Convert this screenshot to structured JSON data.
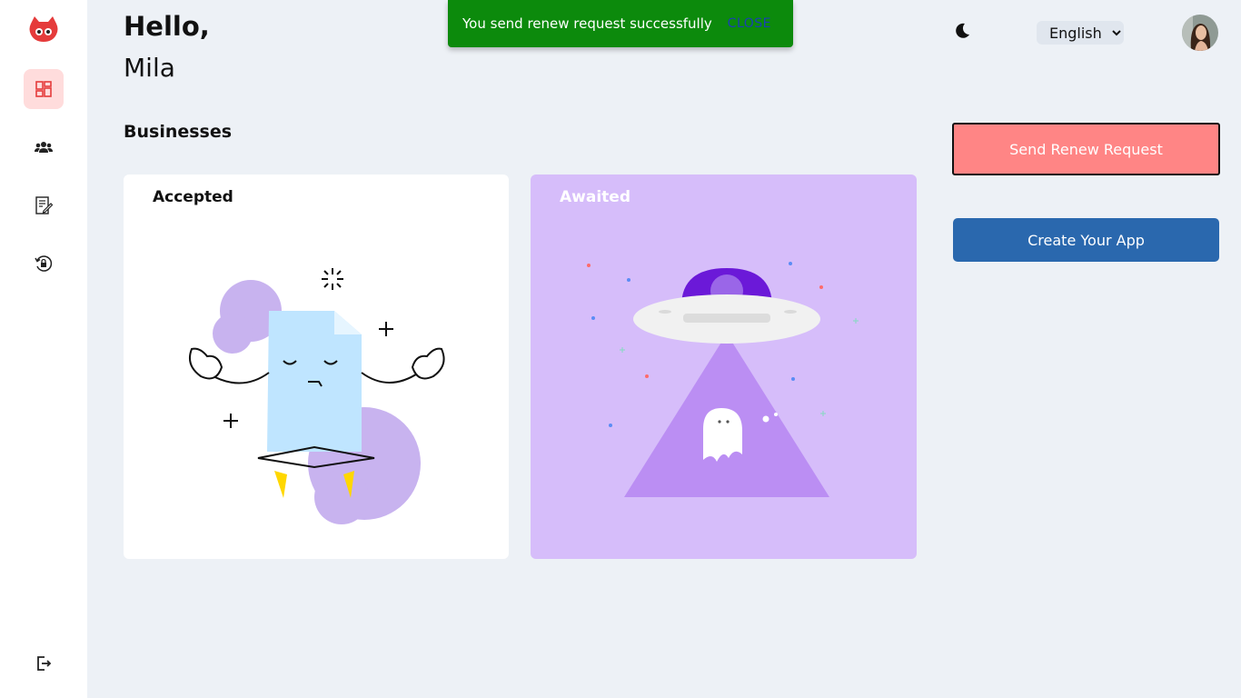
{
  "greeting": {
    "hello": "Hello,",
    "name": "Mila"
  },
  "section": {
    "title": "Businesses"
  },
  "cards": [
    {
      "label": "Accepted",
      "illustration": "meditating-document"
    },
    {
      "label": "Awaited",
      "illustration": "ufo-ghost"
    }
  ],
  "snackbar": {
    "message": "You send renew request successfully",
    "close_label": "CLOSE"
  },
  "header": {
    "language": {
      "selected": "English",
      "options": [
        "English"
      ]
    }
  },
  "actions": {
    "renew_label": "Send Renew Request",
    "create_label": "Create Your App"
  },
  "sidebar": {
    "items": [
      {
        "name": "dashboard",
        "icon": "dashboard-icon",
        "active": true
      },
      {
        "name": "users",
        "icon": "users-icon",
        "active": false
      },
      {
        "name": "requests",
        "icon": "document-edit-icon",
        "active": false
      },
      {
        "name": "renew",
        "icon": "lock-rotate-icon",
        "active": false
      }
    ],
    "logout_icon": "logout-icon"
  },
  "colors": {
    "accent": "#ff8585",
    "primary": "#2a68ae",
    "success": "#0c8a0c",
    "awaited_card": "#d6bdfa",
    "background": "#edf1f6"
  }
}
